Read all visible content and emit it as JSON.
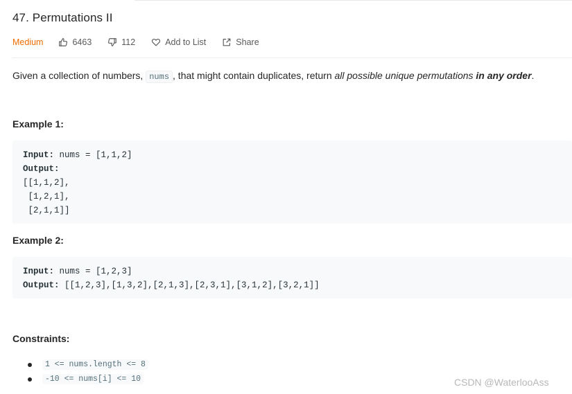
{
  "problem": {
    "title": "47. Permutations II",
    "difficulty": "Medium",
    "likes": "6463",
    "dislikes": "112",
    "add_to_list": "Add to List",
    "share": "Share"
  },
  "description": {
    "part1": "Given a collection of numbers, ",
    "code": "nums",
    "part2": ", that might contain duplicates, return ",
    "italic": "all possible unique permutations",
    "part3": " ",
    "bold_italic": "in any order",
    "part4": "."
  },
  "examples": [
    {
      "heading": "Example 1:",
      "input_label": "Input:",
      "input_value": " nums = [1,1,2]",
      "output_label": "Output:",
      "output_lines": [
        "[[1,1,2],",
        " [1,2,1],",
        " [2,1,1]]"
      ]
    },
    {
      "heading": "Example 2:",
      "input_label": "Input:",
      "input_value": " nums = [1,2,3]",
      "output_label": "Output:",
      "output_value": " [[1,2,3],[1,3,2],[2,1,3],[2,3,1],[3,1,2],[3,2,1]]"
    }
  ],
  "constraints": {
    "heading": "Constraints:",
    "items": [
      "1 <= nums.length <= 8",
      "-10 <= nums[i] <= 10"
    ]
  },
  "watermark": "CSDN @WaterlooAss",
  "colors": {
    "difficulty_medium": "#ef6c00",
    "code_background": "#f7f9fa",
    "text": "#262626"
  },
  "icons": [
    "thumbs-up-icon",
    "thumbs-down-icon",
    "heart-icon",
    "share-icon"
  ]
}
